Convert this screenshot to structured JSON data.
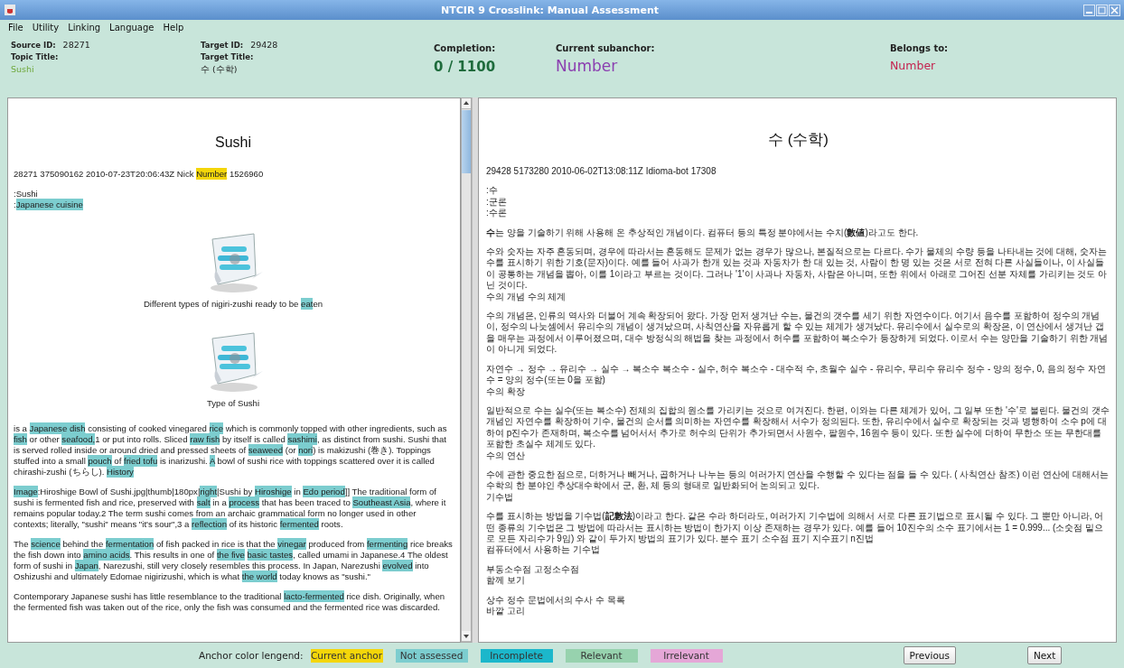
{
  "window": {
    "title": "NTCIR 9 Crosslink: Manual Assessment"
  },
  "menu": [
    "File",
    "Utility",
    "Linking",
    "Language",
    "Help"
  ],
  "header": {
    "source_id": {
      "label": "Source ID:",
      "value": "28271"
    },
    "topic_title": {
      "label": "Topic Title:",
      "value": "Sushi"
    },
    "target_id": {
      "label": "Target ID:",
      "value": "29428"
    },
    "target_title": {
      "label": "Target Title:",
      "value": "수 (수학)"
    },
    "completion": {
      "label": "Completion:",
      "value": "0 / 1100"
    },
    "current_subanchor": {
      "label": "Current subanchor:",
      "value": "Number"
    },
    "belongs_to": {
      "label": "Belongs to:",
      "value": "Number"
    }
  },
  "source_article": {
    "title": "Sushi",
    "blocks": [
      {
        "kind": "paragraph",
        "lines": [
          [
            {
              "kind": "text",
              "text": "28271 375090162 2010-07-23T20:06:43Z Nick "
            },
            {
              "kind": "anchor",
              "text": "Number",
              "color": "#f4d60a"
            },
            {
              "kind": "text",
              "text": " 1526960"
            }
          ]
        ]
      },
      {
        "kind": "paragraph",
        "lines": [
          [
            {
              "kind": "text",
              "text": ":Sushi"
            }
          ],
          [
            {
              "kind": "text",
              "text": ":"
            },
            {
              "kind": "anchor",
              "text": "Japanese cuisine",
              "color": "#7ccdcf"
            }
          ]
        ]
      },
      {
        "kind": "figure",
        "caption": [
          {
            "kind": "text",
            "text": "Different types of nigiri-zushi ready to be "
          },
          {
            "kind": "anchor",
            "text": "eat",
            "color": "#7ccdcf"
          },
          {
            "kind": "text",
            "text": "en"
          }
        ]
      },
      {
        "kind": "figure",
        "caption": [
          {
            "kind": "text",
            "text": "Type of Sushi"
          }
        ]
      },
      {
        "kind": "paragraph",
        "lines": [
          [
            {
              "kind": "text",
              "text": "is a "
            },
            {
              "kind": "anchor",
              "text": "Japanese dish",
              "color": "#7ccdcf"
            },
            {
              "kind": "text",
              "text": " consisting of cooked vinegared "
            },
            {
              "kind": "anchor",
              "text": "rice",
              "color": "#7ccdcf"
            },
            {
              "kind": "text",
              "text": " which is commonly topped with other ingredients, such as "
            },
            {
              "kind": "anchor",
              "text": "fish",
              "color": "#7ccdcf"
            },
            {
              "kind": "text",
              "text": " or other "
            },
            {
              "kind": "anchor",
              "text": "seafood,",
              "color": "#7ccdcf"
            },
            {
              "kind": "text",
              "text": "1 or put into rolls. Sliced "
            },
            {
              "kind": "anchor",
              "text": "raw fish",
              "color": "#7ccdcf"
            },
            {
              "kind": "text",
              "text": " by itself is called "
            },
            {
              "kind": "anchor",
              "text": "sashimi",
              "color": "#7ccdcf"
            },
            {
              "kind": "text",
              "text": ", as distinct from sushi. Sushi that is served rolled inside or around dried and pressed sheets of "
            },
            {
              "kind": "anchor",
              "text": "seaweed",
              "color": "#7ccdcf"
            },
            {
              "kind": "text",
              "text": " (or "
            },
            {
              "kind": "anchor",
              "text": "nori",
              "color": "#7ccdcf"
            },
            {
              "kind": "text",
              "text": ") is makizushi (巻き). Toppings stuffed into a small "
            },
            {
              "kind": "anchor",
              "text": "pouch",
              "color": "#7ccdcf"
            },
            {
              "kind": "text",
              "text": " of "
            },
            {
              "kind": "anchor",
              "text": "fried tofu",
              "color": "#7ccdcf"
            },
            {
              "kind": "text",
              "text": " is inarizushi. "
            },
            {
              "kind": "anchor",
              "text": "A",
              "color": "#7ccdcf"
            },
            {
              "kind": "text",
              "text": " bowl of sushi rice with toppings scattered over it is called chirashi-zushi (ちらし). "
            },
            {
              "kind": "anchor",
              "text": "History",
              "color": "#7ccdcf"
            }
          ]
        ]
      },
      {
        "kind": "paragraph",
        "lines": [
          [
            {
              "kind": "anchor",
              "text": "Image",
              "color": "#7ccdcf"
            },
            {
              "kind": "text",
              "text": ":Hiroshige Bowl of Sushi.jpg|thumb|180px|"
            },
            {
              "kind": "anchor",
              "text": "right",
              "color": "#7ccdcf"
            },
            {
              "kind": "text",
              "text": "|Sushi by "
            },
            {
              "kind": "anchor",
              "text": "Hiroshige",
              "color": "#7ccdcf"
            },
            {
              "kind": "text",
              "text": " in "
            },
            {
              "kind": "anchor",
              "text": "Edo period",
              "color": "#7ccdcf"
            },
            {
              "kind": "text",
              "text": "]] The traditional form of sushi is fermented fish and rice, preserved with "
            },
            {
              "kind": "anchor",
              "text": "salt",
              "color": "#7ccdcf"
            },
            {
              "kind": "text",
              "text": " in a "
            },
            {
              "kind": "anchor",
              "text": "process",
              "color": "#7ccdcf"
            },
            {
              "kind": "text",
              "text": " that has been traced to "
            },
            {
              "kind": "anchor",
              "text": "Southeast Asia",
              "color": "#7ccdcf"
            },
            {
              "kind": "text",
              "text": ", where it remains popular today.2 The term sushi comes from an archaic grammatical form no longer used in other contexts; literally, \"sushi\" means \"it's sour\",3 a "
            },
            {
              "kind": "anchor",
              "text": "reflection",
              "color": "#7ccdcf"
            },
            {
              "kind": "text",
              "text": " of its historic "
            },
            {
              "kind": "anchor",
              "text": "fermented",
              "color": "#7ccdcf"
            },
            {
              "kind": "text",
              "text": " roots."
            }
          ]
        ]
      },
      {
        "kind": "paragraph",
        "lines": [
          [
            {
              "kind": "text",
              "text": "The "
            },
            {
              "kind": "anchor",
              "text": "science",
              "color": "#7ccdcf"
            },
            {
              "kind": "text",
              "text": " behind the "
            },
            {
              "kind": "anchor",
              "text": "fermentation",
              "color": "#7ccdcf"
            },
            {
              "kind": "text",
              "text": " of fish packed in rice is that the "
            },
            {
              "kind": "anchor",
              "text": "vinegar",
              "color": "#7ccdcf"
            },
            {
              "kind": "text",
              "text": " produced from "
            },
            {
              "kind": "anchor",
              "text": "fermenting",
              "color": "#7ccdcf"
            },
            {
              "kind": "text",
              "text": " rice breaks the fish down into "
            },
            {
              "kind": "anchor",
              "text": "amino acids",
              "color": "#7ccdcf"
            },
            {
              "kind": "text",
              "text": ". This results in one of "
            },
            {
              "kind": "anchor",
              "text": "the five",
              "color": "#7ccdcf"
            },
            {
              "kind": "anchor",
              "text": "basic tastes",
              "color": "#7ccdcf"
            },
            {
              "kind": "text",
              "text": ", called umami in Japanese.4 The oldest form of sushi in "
            },
            {
              "kind": "anchor",
              "text": "Japan",
              "color": "#7ccdcf"
            },
            {
              "kind": "text",
              "text": ", Narezushi, still very closely resembles this process. In Japan, Narezushi "
            },
            {
              "kind": "anchor",
              "text": "evolved",
              "color": "#7ccdcf"
            },
            {
              "kind": "text",
              "text": " into Oshizushi and ultimately Edomae nigirizushi, which is what "
            },
            {
              "kind": "anchor",
              "text": "the world",
              "color": "#7ccdcf"
            },
            {
              "kind": "text",
              "text": " today knows as \"sushi.\""
            }
          ]
        ]
      },
      {
        "kind": "paragraph",
        "lines": [
          [
            {
              "kind": "text",
              "text": "Contemporary Japanese sushi has little resemblance to the traditional "
            },
            {
              "kind": "anchor",
              "text": "lacto-fermented",
              "color": "#7ccdcf"
            },
            {
              "kind": "text",
              "text": " rice dish. Originally, when the fermented fish was taken out of the rice, only the fish was consumed and the fermented rice was discarded."
            }
          ]
        ]
      }
    ]
  },
  "target_article": {
    "title": "수 (수학)",
    "paragraphs": [
      [
        "29428 5173280 2010-06-02T13:08:11Z Idioma-bot 17308"
      ],
      [
        ":수",
        ":군론",
        ":수론"
      ],
      [
        "**수**는 양을 기술하기 위해 사용해 온 추상적인 개념이다. 컴퓨터 등의 특정 분야에서는 수치(**數値**)라고도 한다."
      ],
      [
        "수와 숫자는 자주 혼동되며, 경우에 따라서는 혼동해도 문제가 없는 경우가 많으나, 본질적으로는 다르다. 수가 물체의 수량 등을 나타내는 것에 대해, 숫자는 수를 표시하기 위한 기호(문자)이다. 예를 들어 사과가 한개 있는 것과 자동차가 한 대 있는 것, 사람이 한 명 있는 것은 서로 전혀 다른 사실들이나, 이 사실들이 공통하는 개념을 뽑아, 이를 1이라고 부르는 것이다. 그러나 '1'이 사과나 자동차, 사람은 아니며, 또한 위에서 아래로 그어진 선분 자체를 가리키는 것도 아닌 것이다.",
        "수의 개념 수의 체계"
      ],
      [
        "수의 개념은, 인류의 역사와 더불어 계속 확장되어 왔다. 가장 먼저 생겨난 수는, 물건의 갯수를 세기 위한 자연수이다. 여기서 음수를 포함하여 정수의 개념이, 정수의 나눗셈에서 유리수의 개념이 생겨났으며, 사칙연산을 자유롭게 할 수 있는 체계가 생겨났다. 유리수에서 실수로의 확장은, 이 연산에서 생겨난 갭을 매우는 과정에서 이루어졌으며, 대수 방정식의 해법을 찾는 과정에서 허수를 포함하여 복소수가 등장하게 되었다. 이로서 수는 양만을 기술하기 위한 개념이 아니게 되었다."
      ],
      [
        "자연수 → 정수 → 유리수 → 실수 → 복소수 복소수 - 실수, 허수 복소수 - 대수적 수, 초월수 실수 - 유리수, 무리수 유리수 정수 - 양의 정수, 0, 음의 정수 자연수 = 양의 정수(또는 0을 포함)",
        "수의 확장"
      ],
      [
        "일반적으로 수는 실수(또는 복소수) 전체의 집합의 원소를 가리키는 것으로 여겨진다. 한편, 이와는 다른 체계가 있어, 그 일부 또한 '수'로 불린다. 물건의 갯수 개념인 자연수를 확장하여 기수, 물건의 순서를 의미하는 자연수를 확장해서 서수가 정의된다. 또한, 유리수에서 실수로 확장되는 것과 병행하여 소수 p에 대하여 p진수가 존재하며, 복소수를 넘어서서 추가로 허수의 단위가 추가되면서 사원수, 팔원수, 16원수 등이 있다. 또한 실수에 더하여 무한소 또는 무한대를 포함한 초실수 체계도 있다.",
        "수의 연산"
      ],
      [
        "수에 관한 중요한 점으로, 더하거나 빼거나, 곱하거나 나누는 등의 여러가지 연산을 수행할 수 있다는 점을 들 수 있다. ( 사칙연산 참조) 이런 연산에 대해서는 수학의 한 분야인 추상대수학에서 군, 환, 체 등의 형태로 일반화되어 논의되고 있다.",
        "기수법"
      ],
      [
        "수를 표시하는 방법을 기수법(**記數法**)이라고 한다. 같은 수라 하더라도, 여러가지 기수법에 의해서 서로 다른 표기법으로 표시될 수 있다. 그 뿐만 아니라, 어떤 종류의 기수법은 그 방법에 따라서는 표시하는 방법이 한가지 이상 존재하는 경우가 있다. 예를 들어 10진수의 소수 표기에서는 1 = 0.999... (소숫점 밑으로 모든 자리수가 9임) 와 같이 두가지 방법의 표기가 있다. 분수 표기 소수점 표기 지수표기 n진법",
        "컴퓨터에서 사용하는 기수법"
      ],
      [
        "부동소수점 고정소수점",
        "함께 보기"
      ],
      [
        "상수 정수 문법에서의 수사 수 목록",
        "바깥 고리"
      ]
    ]
  },
  "footer": {
    "legend_label": "Anchor color lengend:",
    "legend": [
      {
        "label": "Current anchor",
        "color": "#f4d60a"
      },
      {
        "label": "Not assessed",
        "color": "#7ccdcf"
      },
      {
        "label": "Incomplete",
        "color": "#1cb7cb"
      },
      {
        "label": "Relevant",
        "color": "#97d2ae"
      },
      {
        "label": "Irrelevant",
        "color": "#e5a7d7"
      }
    ],
    "buttons": [
      {
        "kind": "previous",
        "label": "Previous"
      },
      {
        "kind": "next",
        "label": "Next"
      }
    ]
  }
}
